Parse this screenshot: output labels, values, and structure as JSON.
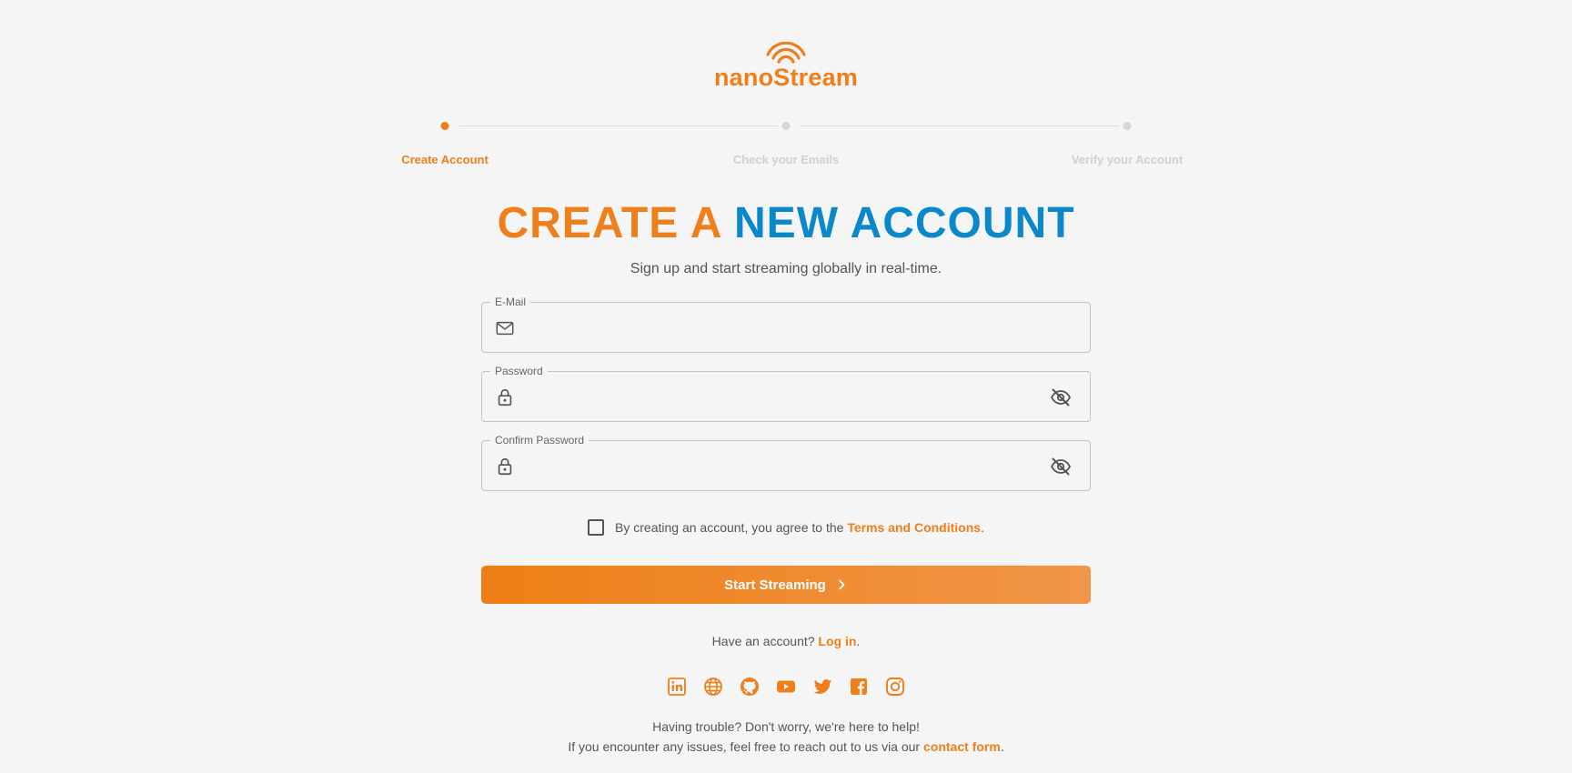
{
  "brand": {
    "name": "nanoStream",
    "accent": "#ee7f1a",
    "secondary": "#0a88c9"
  },
  "stepper": {
    "steps": [
      {
        "label": "Create Account",
        "active": true
      },
      {
        "label": "Check your Emails",
        "active": false
      },
      {
        "label": "Verify your Account",
        "active": false
      }
    ]
  },
  "heading": {
    "part1": "CREATE A ",
    "part2": "NEW ACCOUNT"
  },
  "subheading": "Sign up and start streaming globally in real-time.",
  "form": {
    "email": {
      "label": "E-Mail",
      "value": "",
      "icon": "mail-icon"
    },
    "password": {
      "label": "Password",
      "value": "",
      "icon": "lock-icon",
      "toggle_icon": "eye-off-icon"
    },
    "confirm_password": {
      "label": "Confirm Password",
      "value": "",
      "icon": "lock-icon",
      "toggle_icon": "eye-off-icon"
    }
  },
  "terms": {
    "checked": false,
    "text": "By creating an account, you agree to the ",
    "link": "Terms and Conditions",
    "suffix": "."
  },
  "submit": {
    "label": "Start Streaming",
    "icon": "chevron-right-icon"
  },
  "login": {
    "text": "Have an account? ",
    "link": "Log in",
    "suffix": "."
  },
  "socials": [
    "linkedin-icon",
    "globe-icon",
    "github-icon",
    "youtube-icon",
    "twitter-icon",
    "facebook-icon",
    "instagram-icon"
  ],
  "help": {
    "line1": "Having trouble? Don't worry, we're here to help!",
    "line2_text": "If you encounter any issues, feel free to reach out to us via our ",
    "line2_link": "contact form",
    "line2_suffix": "."
  }
}
